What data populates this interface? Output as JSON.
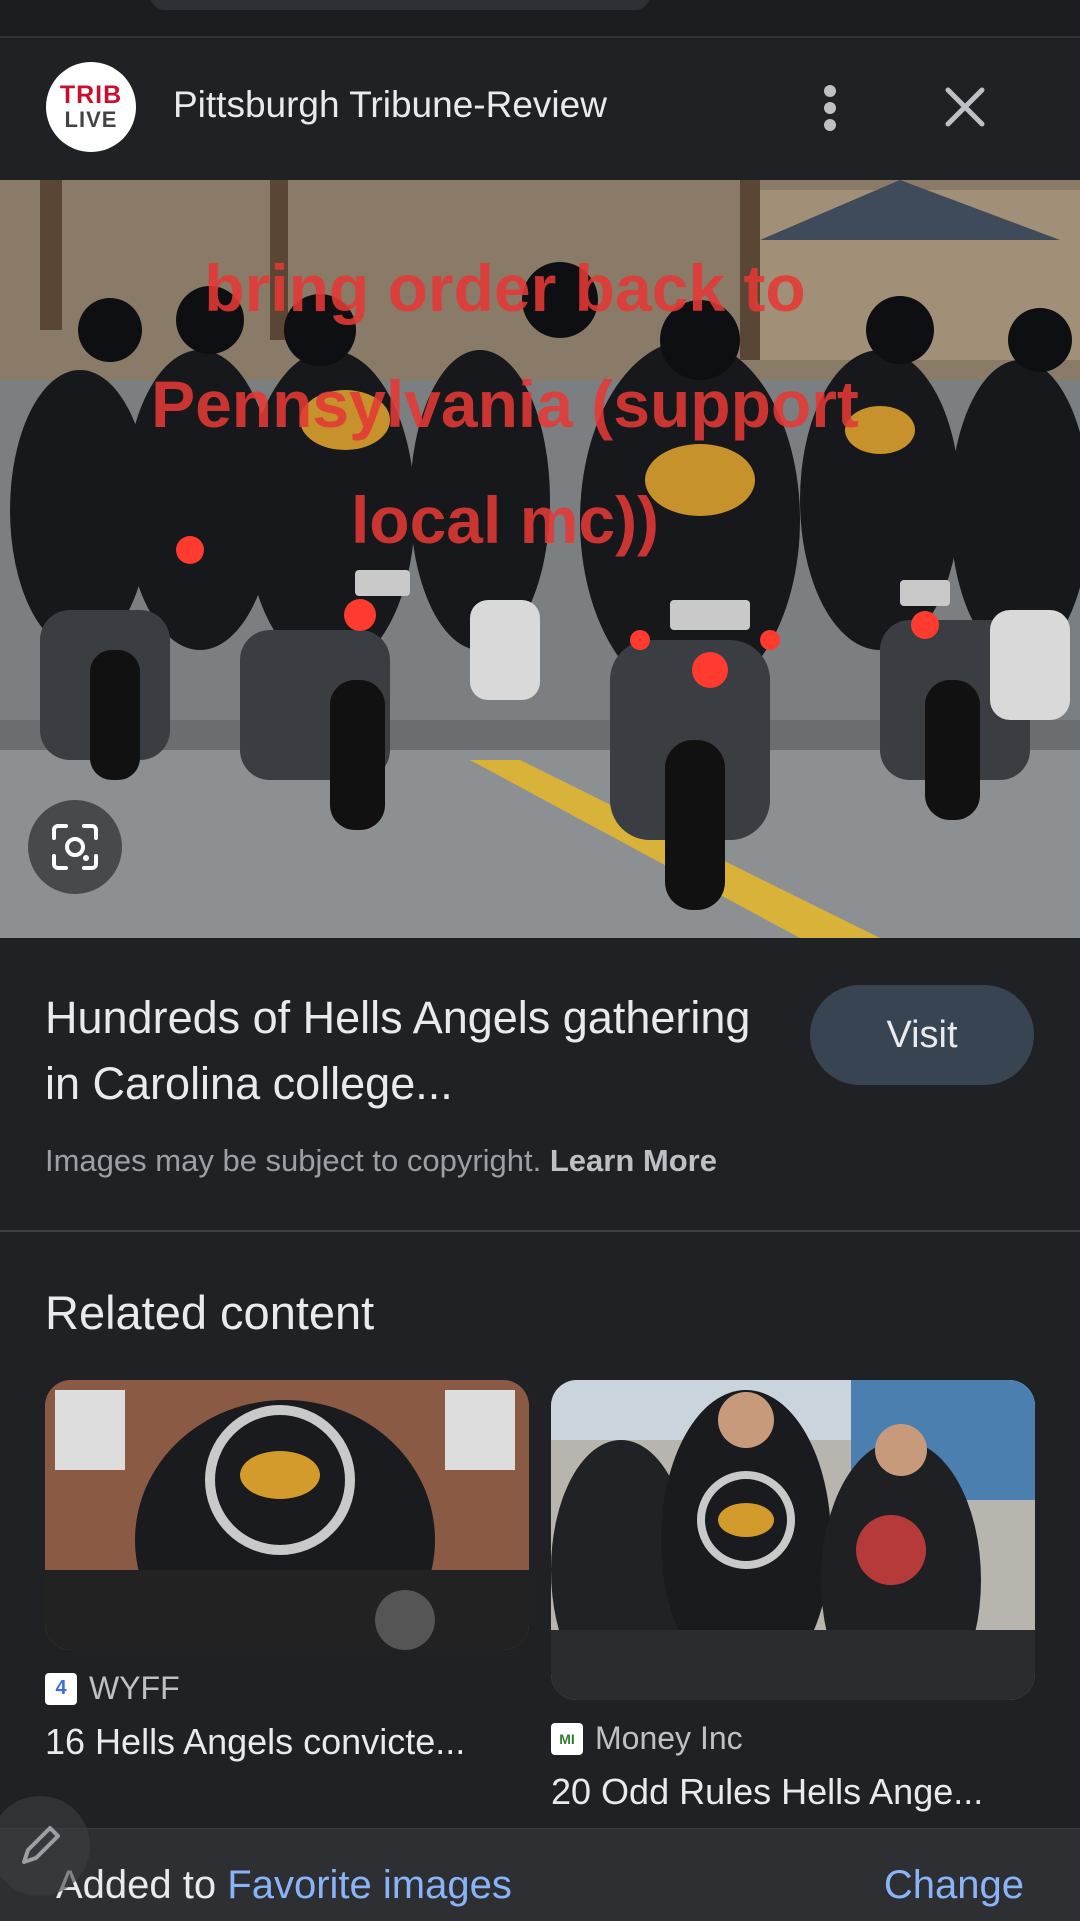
{
  "header": {
    "logo_line1": "TRIB",
    "logo_line2": "LIVE",
    "source_name": "Pittsburgh Tribune-Review",
    "more_icon": "more-vert-icon",
    "close_icon": "close-icon"
  },
  "hero": {
    "overlay_text": "bring order back to Pennsylvania (support local mc))",
    "lens_icon": "google-lens-icon"
  },
  "result": {
    "title": "Hundreds of Hells Angels gathering in Carolina college...",
    "visit_label": "Visit",
    "copyright_text": "Images may be subject to copyright.",
    "learn_more": "Learn More"
  },
  "related": {
    "heading": "Related content",
    "items": [
      {
        "source": "WYFF",
        "caption": "16 Hells Angels convicte..."
      },
      {
        "source": "Money Inc",
        "caption": "20 Odd Rules Hells Ange..."
      }
    ]
  },
  "snackbar": {
    "prefix": "Added to",
    "link": "Favorite images",
    "action": "Change"
  },
  "colors": {
    "background": "#202124",
    "accent_link": "#8ab4f8",
    "overlay_text": "#e53935",
    "visit_button": "#394453"
  }
}
